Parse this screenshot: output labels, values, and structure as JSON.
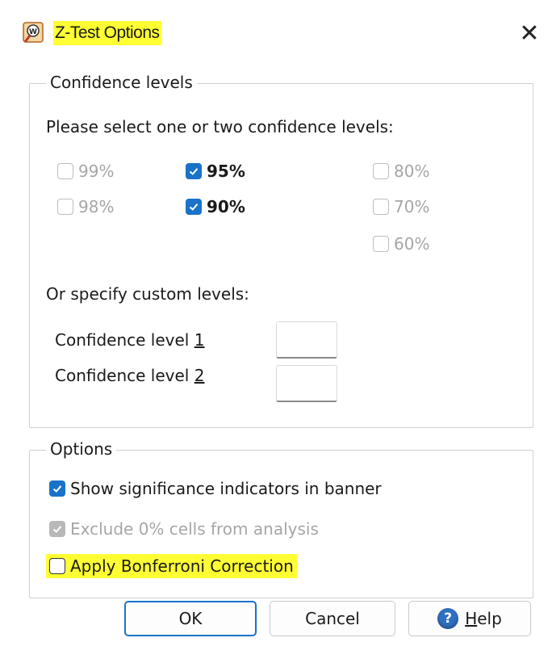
{
  "window": {
    "title": "Z-Test Options",
    "close_symbol": "✕",
    "title_highlight_color": "#ffff33"
  },
  "confidence_group": {
    "legend": "Confidence levels",
    "instruction": "Please select one or two confidence levels:",
    "levels": [
      {
        "label": "99%",
        "checked": false,
        "enabled": false
      },
      {
        "label": "98%",
        "checked": false,
        "enabled": false
      },
      {
        "label": "95%",
        "checked": true,
        "enabled": true
      },
      {
        "label": "90%",
        "checked": true,
        "enabled": true
      },
      {
        "label": "80%",
        "checked": false,
        "enabled": false
      },
      {
        "label": "70%",
        "checked": false,
        "enabled": false
      },
      {
        "label": "60%",
        "checked": false,
        "enabled": false
      }
    ],
    "custom_prompt": "Or specify custom levels:",
    "custom_level_1_prefix": "Confidence level ",
    "custom_level_1_key": "1",
    "custom_level_1_value": "",
    "custom_level_2_prefix": "Confidence level ",
    "custom_level_2_key": "2",
    "custom_level_2_value": ""
  },
  "options_group": {
    "legend": "Options",
    "show_significance": {
      "label": "Show significance indicators in banner",
      "checked": true,
      "enabled": true
    },
    "exclude_zero": {
      "label": "Exclude 0% cells from analysis",
      "checked": true,
      "enabled": false
    },
    "bonferroni": {
      "label": "Apply Bonferroni Correction",
      "checked": false,
      "enabled": true
    }
  },
  "buttons": {
    "ok": "OK",
    "cancel": "Cancel",
    "help_key": "H",
    "help_rest": "elp",
    "help_icon_glyph": "?"
  },
  "colors": {
    "accent": "#1a73c9",
    "highlight": "#ffff33",
    "disabled_text": "#a6a6a6"
  }
}
